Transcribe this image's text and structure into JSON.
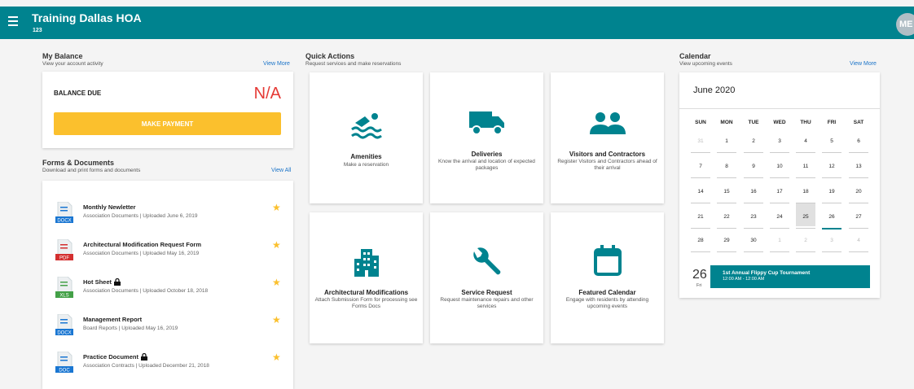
{
  "header": {
    "title": "Training Dallas HOA",
    "subtitle": "123",
    "avatar": "ME"
  },
  "balance": {
    "title": "My Balance",
    "subtitle": "View your account activity",
    "link": "View More",
    "label": "BALANCE DUE",
    "value": "N/A",
    "button": "MAKE PAYMENT"
  },
  "forms": {
    "title": "Forms & Documents",
    "subtitle": "Download and print forms and documents",
    "link": "View All",
    "items": [
      {
        "name": "Monthly Newletter",
        "meta": "Association Documents | Uploaded June 6, 2019",
        "type": "DOCX"
      },
      {
        "name": "Architectural Modification Request Form",
        "meta": "Association Documents | Uploaded May 16, 2019",
        "type": "PDF"
      },
      {
        "name": "Hot Sheet",
        "meta": "Association Documents | Uploaded October 18, 2018",
        "type": "XLS"
      },
      {
        "name": "Management Report",
        "meta": "Board Reports | Uploaded May 16, 2019",
        "type": "DOCX"
      },
      {
        "name": "Practice Document",
        "meta": "Association Contracts | Uploaded December 21, 2018",
        "type": "DOC"
      }
    ]
  },
  "quick": {
    "title": "Quick Actions",
    "subtitle": "Request services and make reservations",
    "items": [
      {
        "title": "Amenities",
        "desc": "Make a reservation"
      },
      {
        "title": "Deliveries",
        "desc": "Know the arrival and location of expected packages"
      },
      {
        "title": "Visitors and Contractors",
        "desc": "Register Visitors and Contractors ahead of their arrival"
      },
      {
        "title": "Architectural Modifications",
        "desc": "Attach Submission Form for processing see Forms Docs"
      },
      {
        "title": "Service Request",
        "desc": "Request maintenance repairs and other services"
      },
      {
        "title": "Featured Calendar",
        "desc": "Engage with residents by attending upcoming events"
      }
    ]
  },
  "calendar": {
    "title": "Calendar",
    "subtitle": "View upcoming events",
    "link": "View More",
    "month": "June 2020",
    "dow": [
      "SUN",
      "MON",
      "TUE",
      "WED",
      "THU",
      "FRI",
      "SAT"
    ],
    "weeks": [
      [
        "31",
        "1",
        "2",
        "3",
        "4",
        "5",
        "6"
      ],
      [
        "7",
        "8",
        "9",
        "10",
        "11",
        "12",
        "13"
      ],
      [
        "14",
        "15",
        "16",
        "17",
        "18",
        "19",
        "20"
      ],
      [
        "21",
        "22",
        "23",
        "24",
        "25",
        "26",
        "27"
      ],
      [
        "28",
        "29",
        "30",
        "1",
        "2",
        "3",
        "4"
      ]
    ],
    "event": {
      "day": "26",
      "dow": "Fri",
      "title": "1st Annual Flippy Cup Tournament",
      "time": "12:00 AM - 12:00 AM"
    }
  },
  "colors": {
    "brand": "#00838f",
    "accent": "#fbc02d",
    "alert": "#e53935"
  }
}
